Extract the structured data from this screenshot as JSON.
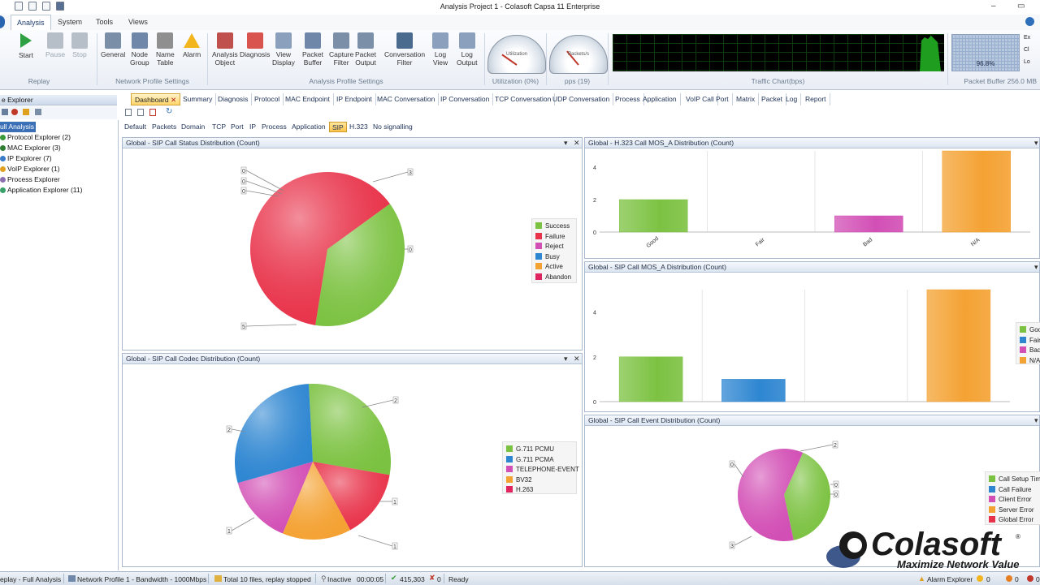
{
  "window": {
    "title": "Analysis Project 1 - Colasoft Capsa 11 Enterprise"
  },
  "menu": {
    "items": [
      "Analysis",
      "System",
      "Tools",
      "Views"
    ],
    "active": "Analysis"
  },
  "ribbon": {
    "buttons": [
      {
        "label": "Start",
        "icon": "play-icon",
        "color": "#2ea043",
        "enabled": true
      },
      {
        "label": "Pause",
        "icon": "pause-icon",
        "color": "#b6bec8",
        "enabled": false
      },
      {
        "label": "Stop",
        "icon": "stop-icon",
        "color": "#b6bec8",
        "enabled": false
      },
      {
        "label": "General",
        "icon": "general-icon",
        "color": "#7a8ea8",
        "enabled": true
      },
      {
        "label": "Node\nGroup",
        "icon": "node-group-icon",
        "color": "#6f87a8",
        "enabled": true
      },
      {
        "label": "Name\nTable",
        "icon": "name-table-icon",
        "color": "#8f8f8f",
        "enabled": true
      },
      {
        "label": "Alarm",
        "icon": "alarm-icon",
        "color": "#f2b51d",
        "enabled": true
      },
      {
        "label": "Analysis\nObject",
        "icon": "analysis-object-icon",
        "color": "#c0504d",
        "enabled": true
      },
      {
        "label": "Diagnosis",
        "icon": "diagnosis-icon",
        "color": "#d9534f",
        "enabled": true
      },
      {
        "label": "View\nDisplay",
        "icon": "view-display-icon",
        "color": "#8aa0bd",
        "enabled": true
      },
      {
        "label": "Packet\nBuffer",
        "icon": "packet-buffer-icon",
        "color": "#6f87a8",
        "enabled": true
      },
      {
        "label": "Capture\nFilter",
        "icon": "capture-filter-icon",
        "color": "#7b8fa8",
        "enabled": true
      },
      {
        "label": "Packet\nOutput",
        "icon": "packet-output-icon",
        "color": "#7b8fa8",
        "enabled": true
      },
      {
        "label": "Conversation\nFilter",
        "icon": "conversation-filter-icon",
        "color": "#4a6a8e",
        "enabled": true
      },
      {
        "label": "Log\nView",
        "icon": "log-view-icon",
        "color": "#8aa0bd",
        "enabled": true
      },
      {
        "label": "Log\nOutput",
        "icon": "log-output-icon",
        "color": "#8aa0bd",
        "enabled": true
      }
    ],
    "groups": [
      "Replay",
      "Network Profile Settings",
      "Analysis Profile Settings",
      "Utilization (0%)",
      "pps (19)",
      "Traffic Chart(bps)",
      "Packet Buffer 256.0 MB"
    ],
    "gauges": [
      {
        "label": "Utilization",
        "value": "0%"
      },
      {
        "label": "Packets/s",
        "value": "19"
      }
    ],
    "packet_buffer": {
      "percent": "96.8%",
      "fill": 0.968
    },
    "side_buttons": [
      "Ex",
      "Cl",
      "Lo"
    ]
  },
  "explorer": {
    "title": "e Explorer",
    "items": [
      {
        "label": "ull Analysis",
        "selected": true,
        "color": "#4a7ab8"
      },
      {
        "label": "Protocol Explorer (2)",
        "color": "#3a9a3a"
      },
      {
        "label": "MAC Explorer (3)",
        "color": "#2e7d32"
      },
      {
        "label": "IP Explorer (7)",
        "color": "#3a7bc8"
      },
      {
        "label": "VoIP Explorer (1)",
        "color": "#e0a020"
      },
      {
        "label": "Process Explorer",
        "color": "#8a6fb0"
      },
      {
        "label": "Application Explorer (11)",
        "color": "#3aa06a"
      }
    ]
  },
  "tabs": {
    "items": [
      "Dashboard",
      "Summary",
      "Diagnosis",
      "Protocol",
      "MAC Endpoint",
      "IP Endpoint",
      "MAC Conversation",
      "IP Conversation",
      "TCP Conversation",
      "UDP Conversation",
      "Process",
      "Application",
      "VoIP Call",
      "Port",
      "Matrix",
      "Packet",
      "Log",
      "Report"
    ],
    "active": "Dashboard"
  },
  "subtabs": {
    "items": [
      "Default",
      "Packets",
      "Domain",
      "TCP",
      "Port",
      "IP",
      "Process",
      "Application",
      "SIP",
      "H.323",
      "No signalling"
    ],
    "active": "SIP"
  },
  "panels": {
    "status_title": "Global - SIP Call Status Distribution (Count)",
    "codec_title": "Global - SIP Call Codec Distribution (Count)",
    "h323_title": "Global - H.323 Call MOS_A Distribution (Count)",
    "sip_mos_title": "Global - SIP Call MOS_A Distribution (Count)",
    "event_title": "Global - SIP Call Event Distribution (Count)"
  },
  "chart_data": [
    {
      "type": "pie",
      "title": "Global - SIP Call Status Distribution (Count)",
      "categories": [
        "Success",
        "Failure",
        "Reject",
        "Busy",
        "Active",
        "Abandon"
      ],
      "values": [
        3,
        5,
        0,
        0,
        0,
        0
      ],
      "callouts": [
        "0",
        "0",
        "0",
        "3",
        "0",
        "5"
      ],
      "colors": [
        "#7cc242",
        "#e8334a",
        "#d24fb5",
        "#2e86d1",
        "#f4a233",
        "#e0245e"
      ],
      "legend": "right"
    },
    {
      "type": "pie",
      "title": "Global - SIP Call Codec Distribution (Count)",
      "categories": [
        "G.711 PCMU",
        "G.711 PCMA",
        "TELEPHONE-EVENT",
        "BV32",
        "H.263"
      ],
      "values": [
        2,
        1,
        1,
        1,
        2
      ],
      "slice_colors": [
        "#7cc242",
        "#e8334a",
        "#f4a233",
        "#d24fb5",
        "#2e86d1"
      ],
      "colors": [
        "#7cc242",
        "#2e86d1",
        "#d24fb5",
        "#f4a233",
        "#e0245e"
      ],
      "callouts": [
        "2",
        "1",
        "1",
        "1",
        "2"
      ],
      "legend": "right"
    },
    {
      "type": "bar",
      "title": "Global - H.323 Call MOS_A Distribution (Count)",
      "categories": [
        "Good",
        "Fair",
        "Bad",
        "N/A"
      ],
      "values": [
        2,
        0,
        1,
        5
      ],
      "colors": [
        "#7cc242",
        "#2e86d1",
        "#d24fb5",
        "#f4a233"
      ],
      "ylim": [
        0,
        5
      ],
      "yticks": [
        0,
        2,
        4
      ],
      "grid": true
    },
    {
      "type": "bar",
      "title": "Global - SIP Call MOS_A Distribution (Count)",
      "categories": [
        "Good",
        "Fair",
        "Bad",
        "N/A"
      ],
      "values": [
        2,
        1,
        0,
        5
      ],
      "colors": [
        "#7cc242",
        "#2e86d1",
        "#d24fb5",
        "#f4a233"
      ],
      "legend_labels": [
        "Goo",
        "Fair",
        "Bad",
        "N/A"
      ],
      "ylim": [
        0,
        5
      ],
      "yticks": [
        0,
        2,
        4
      ],
      "grid": true,
      "legend": "right"
    },
    {
      "type": "pie",
      "title": "Global - SIP Call Event Distribution (Count)",
      "categories": [
        "Call Setup Tim",
        "Call Failure",
        "Client Error",
        "Server Error",
        "Global Error"
      ],
      "values": [
        2,
        3,
        0,
        0,
        0
      ],
      "slice_colors": [
        "#7cc242",
        "#d24fb5",
        "#2e86d1",
        "#f4a233",
        "#e8334a"
      ],
      "colors": [
        "#7cc242",
        "#2e86d1",
        "#d24fb5",
        "#f4a233",
        "#e8334a"
      ],
      "callouts": [
        "0",
        "2",
        "0",
        "0",
        "3"
      ],
      "legend": "right"
    }
  ],
  "status": {
    "items": [
      "eplay - Full Analysis",
      "Network Profile 1 - Bandwidth - 1000Mbps",
      "Total 10 files, replay stopped",
      "Inactive",
      "00:00:05",
      "415,303",
      "0",
      "Ready",
      "Alarm Explorer",
      "0",
      "0",
      "0"
    ]
  },
  "logo": {
    "name": "Colasoft",
    "tagline": "Maximize Network Value",
    "mark": "®"
  }
}
